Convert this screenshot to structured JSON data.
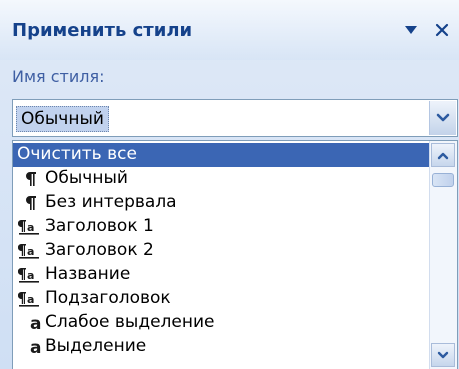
{
  "pane": {
    "title": "Применить стили",
    "menu_icon": "dropdown-triangle-icon",
    "close_label": "×"
  },
  "style_name": {
    "label": "Имя стиля:",
    "value": "Обычный"
  },
  "styles": [
    {
      "label": "Очистить все",
      "icon": "none",
      "selected": true
    },
    {
      "label": "Обычный",
      "icon": "paragraph-mark-icon"
    },
    {
      "label": "Без интервала",
      "icon": "paragraph-mark-icon"
    },
    {
      "label": "Заголовок 1",
      "icon": "linked-style-icon"
    },
    {
      "label": "Заголовок 2",
      "icon": "linked-style-icon"
    },
    {
      "label": "Название",
      "icon": "linked-style-icon"
    },
    {
      "label": "Подзаголовок",
      "icon": "linked-style-icon"
    },
    {
      "label": "Слабое выделение",
      "icon": "character-style-icon"
    },
    {
      "label": "Выделение",
      "icon": "character-style-icon"
    }
  ],
  "colors": {
    "title_text": "#15428b",
    "label_text": "#3f5fa3",
    "selection": "#3b66b4",
    "glyph_dark": "#1a1a1a"
  }
}
